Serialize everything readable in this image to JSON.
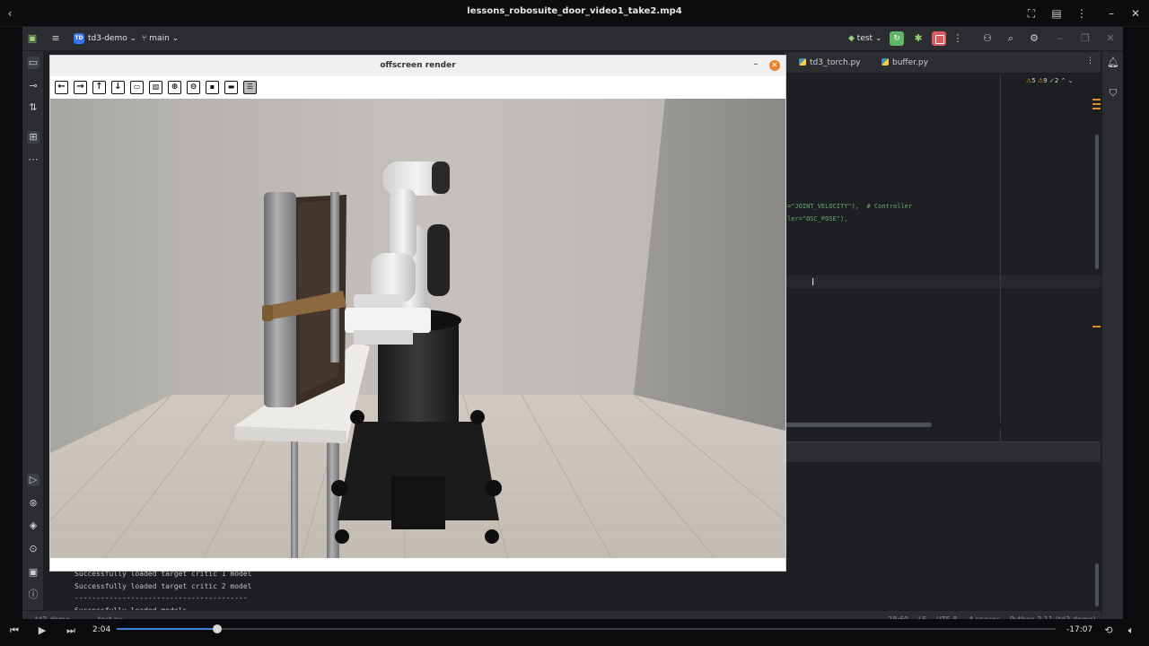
{
  "player": {
    "title": "lessons_robosuite_door_video1_take2.mp4",
    "time_current": "2:04",
    "time_remaining": "-17:07",
    "progress_fraction": 0.107
  },
  "ide": {
    "project": "td3-demo",
    "project_badge": "TD",
    "branch": "main",
    "run_config": "test",
    "tabs": [
      "td3_torch.py",
      "buffer.py"
    ],
    "inspections": {
      "warnings": "5",
      "weak": "9",
      "typos": "2"
    },
    "code_lines": [
      {
        "text": "=\"JOINT_VELOCITY\"),  # Controller"
      },
      {
        "text": "ler=\"OSC_POSE\"),"
      }
    ],
    "console_lines": [
      "Successfully loaded target critic 1 model",
      "Successfully loaded target critic 2 model",
      "----------------------------------------",
      "Successfully loaded models"
    ],
    "status": {
      "position": "28:69",
      "line_sep": "LF",
      "encoding": "UTF-8",
      "indent": "4 spaces",
      "interpreter": "Python 3.11 (td3-demo)"
    },
    "status_left": [
      "td3-demo",
      "test.py"
    ]
  },
  "render_window": {
    "title": "offscreen render",
    "toolbar_icons": [
      "arrow-left-icon",
      "arrow-right-icon",
      "arrow-up-icon",
      "arrow-down-icon",
      "fit-icon",
      "image-icon",
      "zoom-in-icon",
      "zoom-out-icon",
      "save-icon",
      "window-icon",
      "settings-icon"
    ]
  },
  "colors": {
    "ide_bg": "#1e1f22",
    "ide_panel": "#2b2d30",
    "run_green": "#5fb865",
    "stop_red": "#db5c5c",
    "close_orange": "#e9852f",
    "progress_blue": "#3d84d6"
  }
}
